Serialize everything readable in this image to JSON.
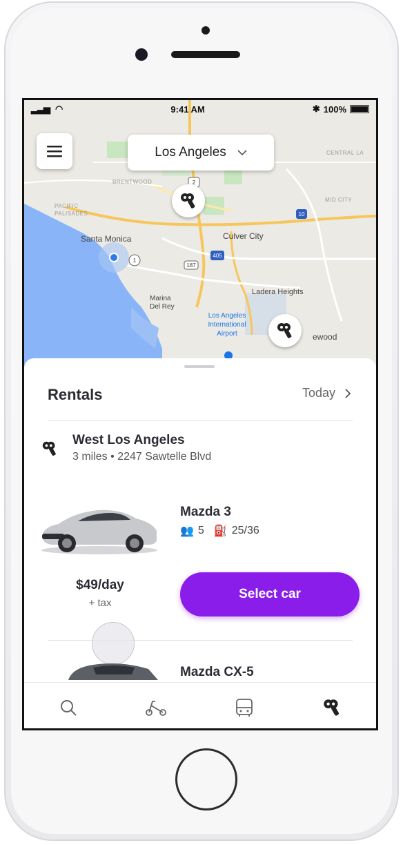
{
  "status_bar": {
    "time": "9:41 AM",
    "battery": "100%"
  },
  "header": {
    "city": "Los Angeles"
  },
  "map": {
    "labels": {
      "brentwood": "BRENTWOOD",
      "pacific_palisades": "PACIFIC PALISADES",
      "santa_monica": "Santa Monica",
      "culver_city": "Culver City",
      "ladera_heights": "Ladera Heights",
      "marina_del_rey": "Marina Del Rey",
      "lax": "Los Angeles International Airport",
      "inglewood_partial": "ewood",
      "central_la": "CENTRAL LA",
      "mid_city": "MID CITY"
    },
    "road_shields": [
      "2",
      "1",
      "187",
      "405",
      "10"
    ]
  },
  "sheet": {
    "title": "Rentals",
    "date_filter": "Today",
    "location": {
      "name": "West Los Angeles",
      "detail": "3 miles • 2247 Sawtelle Blvd"
    },
    "cars": [
      {
        "name": "Mazda 3",
        "seats": "5",
        "mpg": "25/36",
        "price": "$49/day",
        "price_note": "+ tax",
        "action": "Select car"
      },
      {
        "name": "Mazda CX-5"
      }
    ]
  },
  "tabs": [
    {
      "name": "search",
      "icon": "search-icon"
    },
    {
      "name": "bike",
      "icon": "scooter-icon"
    },
    {
      "name": "transit",
      "icon": "bus-icon"
    },
    {
      "name": "rentals",
      "icon": "car-key-icon"
    }
  ],
  "colors": {
    "accent": "#8a1dea",
    "water": "#8ab4f8",
    "map_land": "#eceae4",
    "highway": "#f6c65b"
  }
}
